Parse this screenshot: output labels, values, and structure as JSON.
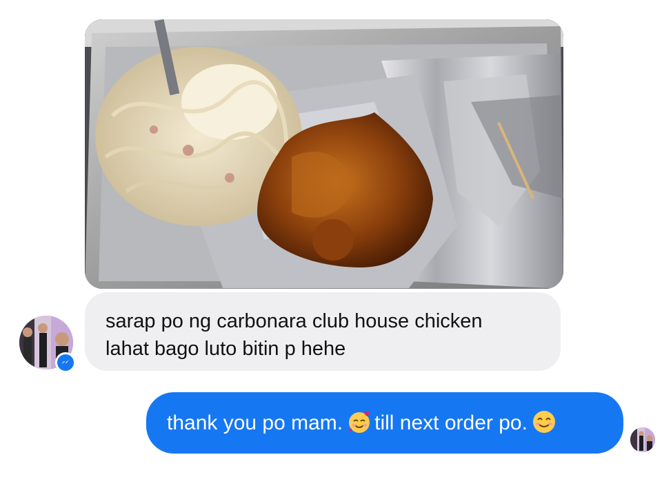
{
  "conversation": {
    "photo": {
      "name": "food-photo",
      "depicts": "carbonara and club house chicken in foil tray"
    },
    "incoming": {
      "line1": "sarap po ng carbonara club house chicken",
      "line2": "lahat bago luto bitin p hehe"
    },
    "outgoing": {
      "part1": "thank you po mam.",
      "emoji1": "smiling-face-with-hearts",
      "part2": " till next order po.",
      "emoji2": "smiling-face"
    },
    "badge_icon": "messenger-icon"
  },
  "colors": {
    "outgoing_bubble": "#1677f2",
    "incoming_bubble": "#efeff1",
    "text_dark": "#111111",
    "text_light": "#ffffff"
  }
}
